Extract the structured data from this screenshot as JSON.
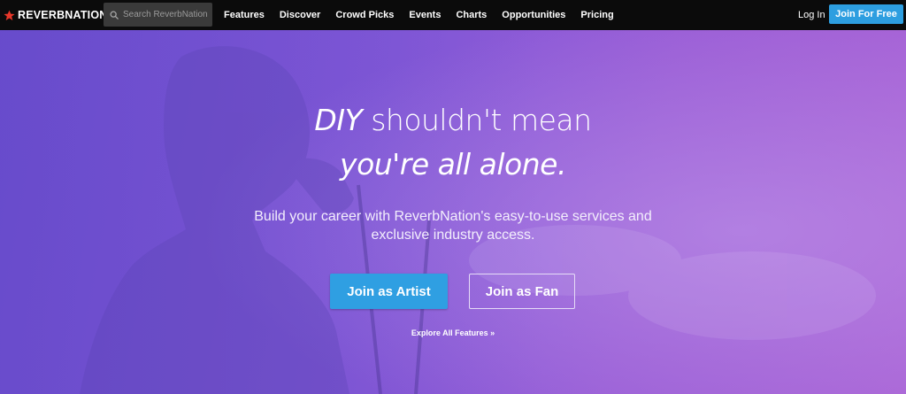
{
  "brand": {
    "logo_text": "REVERBNATION",
    "trademark": "™",
    "accent_color": "#e8372a"
  },
  "search": {
    "placeholder": "Search ReverbNation"
  },
  "nav": {
    "items": [
      {
        "label": "Features"
      },
      {
        "label": "Discover"
      },
      {
        "label": "Crowd Picks"
      },
      {
        "label": "Events"
      },
      {
        "label": "Charts"
      },
      {
        "label": "Opportunities"
      },
      {
        "label": "Pricing"
      }
    ],
    "login_label": "Log In",
    "join_label": "Join For Free",
    "join_color": "#2d9ee0"
  },
  "hero": {
    "headline_line1_em": "DIY",
    "headline_line1_rest": " shouldn't mean",
    "headline_line2_em": "you're all alone.",
    "subtext": "Build your career with ReverbNation's easy-to-use services and exclusive industry access.",
    "artist_button": "Join as Artist",
    "fan_button": "Join as Fan",
    "explore_link": "Explore All Features »",
    "background_color": "#8158d8"
  }
}
